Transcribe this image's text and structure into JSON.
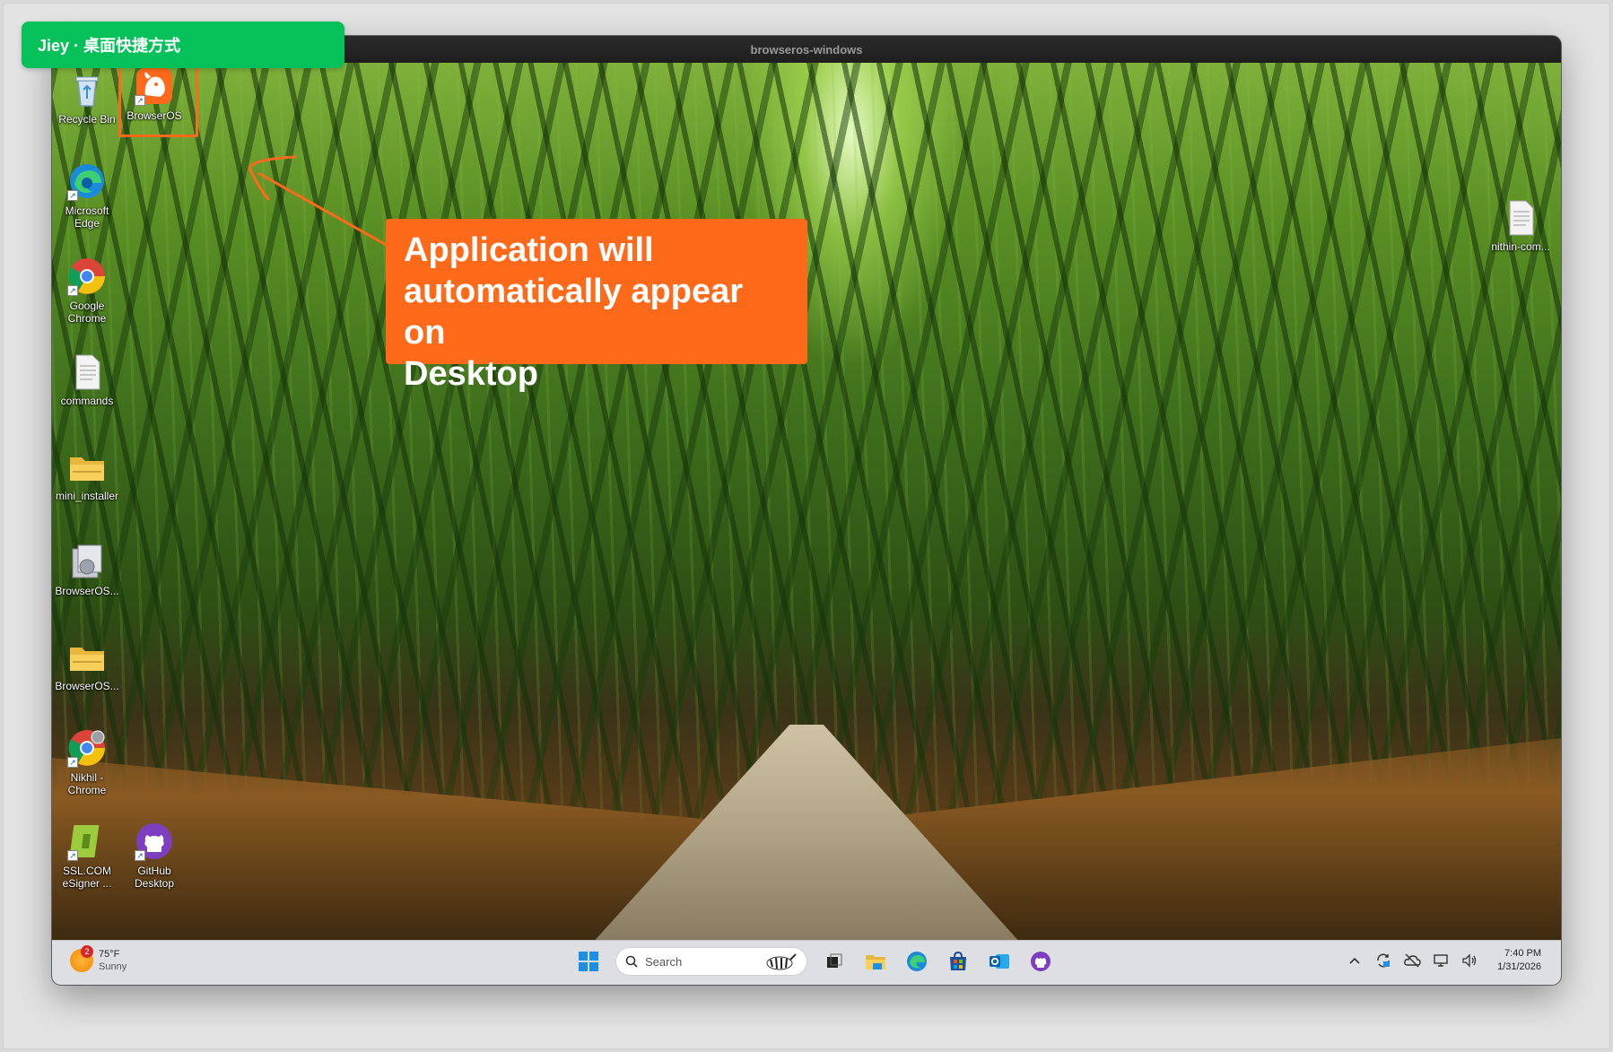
{
  "brand_tag": {
    "label": "Jiey · 桌面快捷方式"
  },
  "window": {
    "title": "browseros-windows"
  },
  "annotation": {
    "text_lines": [
      "Application will",
      "automatically appear on",
      "Desktop"
    ]
  },
  "desktop_icons": {
    "recycle_bin": "Recycle Bin",
    "browseros": "BrowserOS",
    "edge": [
      "Microsoft",
      "Edge"
    ],
    "chrome": [
      "Google",
      "Chrome"
    ],
    "commands": "commands",
    "mini_installer": "mini_installer",
    "browseros_2": "BrowserOS...",
    "browseros_3": "BrowserOS...",
    "nikhil_chrome": [
      "Nikhil -",
      "Chrome"
    ],
    "sslcom": [
      "SSL.COM",
      "eSigner ..."
    ],
    "github": [
      "GitHub",
      "Desktop"
    ],
    "nithin": "nithin-com..."
  },
  "taskbar": {
    "weather": {
      "badge": "2",
      "temp": "75°F",
      "condition": "Sunny"
    },
    "search_label": "Search",
    "clock": {
      "time": "7:40 PM",
      "date": "1/31/2026"
    }
  },
  "colors": {
    "annotation": "#ff6a1a",
    "brand_tag": "#06c15a"
  }
}
